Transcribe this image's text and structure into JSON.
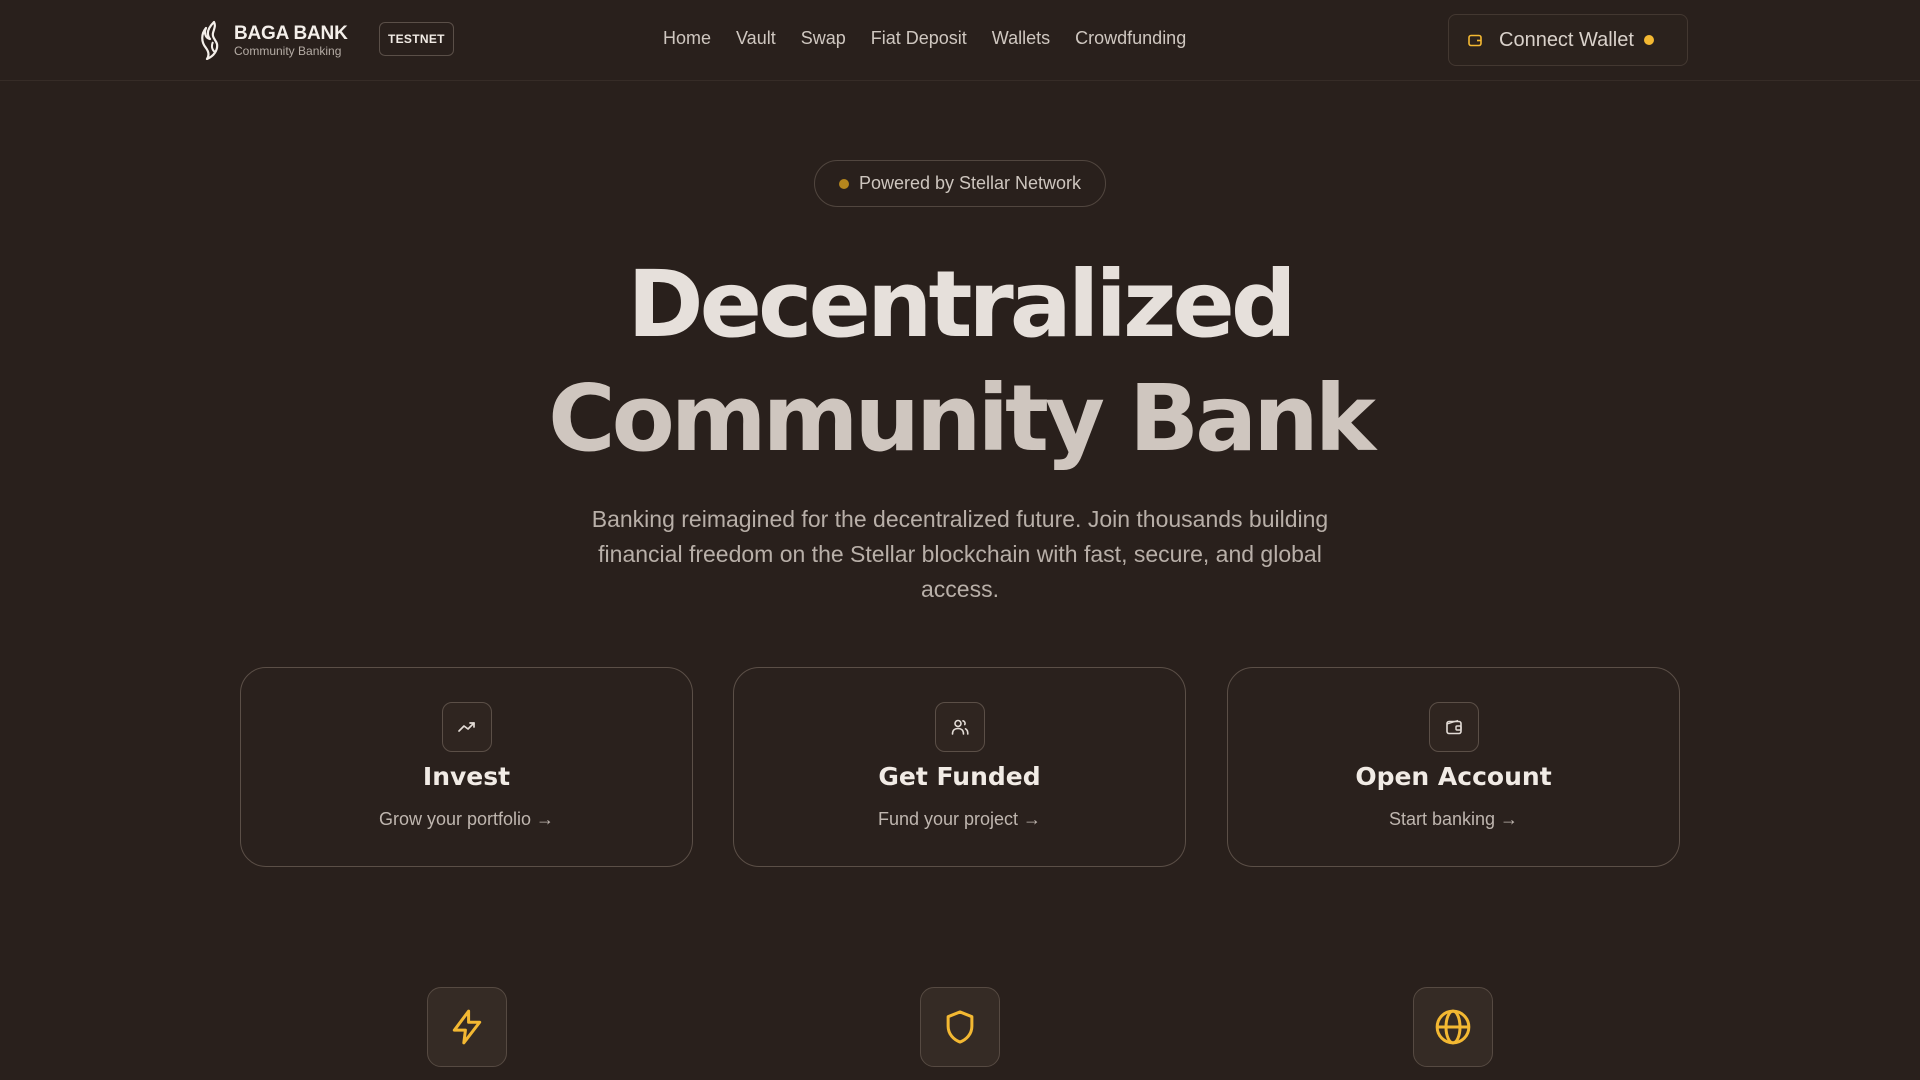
{
  "header": {
    "brand_name": "BAGA BANK",
    "brand_sub": "Community Banking",
    "network_badge": "TESTNET",
    "nav": [
      "Home",
      "Vault",
      "Swap",
      "Fiat Deposit",
      "Wallets",
      "Crowdfunding"
    ],
    "connect_label": "Connect Wallet",
    "connect_icon": "wallet-icon"
  },
  "hero": {
    "pill": "Powered by Stellar Network",
    "title_line1": "Decentralized",
    "title_line2": "Community Bank",
    "lead": "Banking reimagined for the decentralized future. Join thousands building financial freedom on the Stellar blockchain with fast, secure, and global access."
  },
  "cards": [
    {
      "icon": "trending-up-icon",
      "title": "Invest",
      "subtitle": "Grow your portfolio →"
    },
    {
      "icon": "users-icon",
      "title": "Get Funded",
      "subtitle": "Fund your project →"
    },
    {
      "icon": "wallet-icon",
      "title": "Open Account",
      "subtitle": "Start banking →"
    }
  ],
  "features": [
    {
      "icon": "lightning-icon"
    },
    {
      "icon": "shield-icon"
    },
    {
      "icon": "globe-icon"
    }
  ],
  "colors": {
    "background": "#29201c",
    "accent": "#f3b832",
    "accent_muted": "#b5861d",
    "border": "#5b4f47"
  }
}
